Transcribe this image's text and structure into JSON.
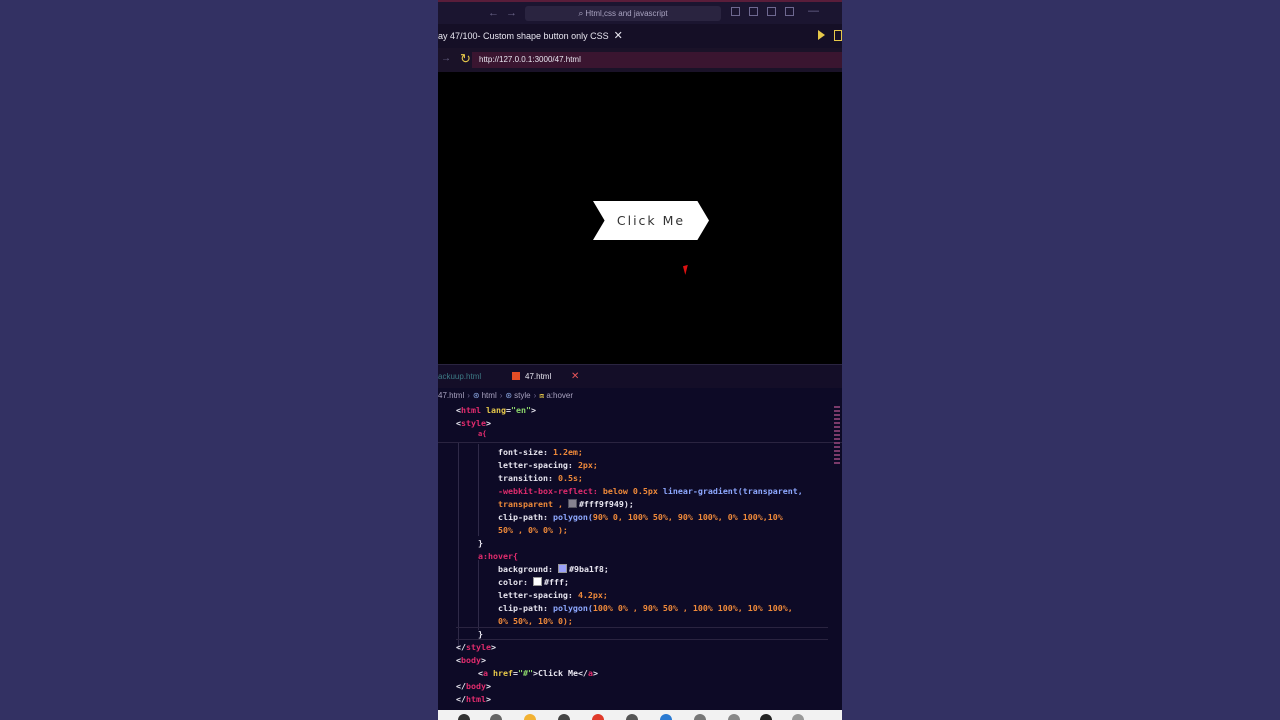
{
  "window": {
    "search_text": "Html,css and javascript"
  },
  "tab": {
    "title": "ay 47/100- Custom shape button only CSS",
    "close": "✕"
  },
  "address": {
    "url": "http://127.0.0.1:3000/47.html"
  },
  "preview": {
    "button_label": "Click Me",
    "button_color": "#ffffff",
    "background_color": "#000000"
  },
  "editor_tabs": [
    {
      "label": "ackuup.html"
    },
    {
      "label": "47.html",
      "close": "✕"
    }
  ],
  "breadcrumb": [
    "47.html",
    "html",
    "style",
    "a:hover"
  ],
  "code": {
    "html_open": "html",
    "lang_attr": "lang",
    "lang_val": "\"en\"",
    "style_tag": "style",
    "a_sel": "a{",
    "prop_font_size": "font-size:",
    "val_font_size": "1.2em;",
    "prop_letter_spacing": "letter-spacing:",
    "val_letter_spacing": "2px;",
    "prop_transition": "transition:",
    "val_transition": "0.5s;",
    "prop_reflect": "-webkit-box-reflect:",
    "val_reflect_a": "below",
    "val_reflect_b": "0.5px",
    "val_reflect_fn": "linear-gradient(transparent,",
    "val_reflect_c": "transparent ,",
    "val_reflect_color": "#fff9f949);",
    "prop_clip": "clip-path:",
    "val_clip_fn": "polygon(",
    "val_clip_1": "90% 0, 100% 50%, 90% 100%, 0% 100%,10%",
    "val_clip_2": "50% , 0% 0% );",
    "close_brace": "}",
    "hover_sel": "a:hover{",
    "prop_background": "background:",
    "val_background": "#9ba1f8;",
    "prop_color": "color:",
    "val_color": "#fff;",
    "prop_ls2": "letter-spacing:",
    "val_ls2": "4.2px;",
    "prop_clip2": "clip-path:",
    "val_clip2_fn": "polygon(",
    "val_clip2_1": "100% 0% , 90% 50% , 100% 100%, 10% 100%,",
    "val_clip2_2": "0% 50%, 10% 0);",
    "close_brace2": "}",
    "style_close": "style",
    "body_open": "body",
    "a_tag": "a",
    "href_attr": "href",
    "href_val": "\"#\"",
    "link_text": ">Click Me</",
    "a_close": "a",
    "body_close": "body",
    "html_close": "html"
  },
  "colors": {
    "swatch_reflect": "#fff9f949",
    "swatch_background": "#9ba1f8",
    "swatch_color": "#ffffff"
  }
}
